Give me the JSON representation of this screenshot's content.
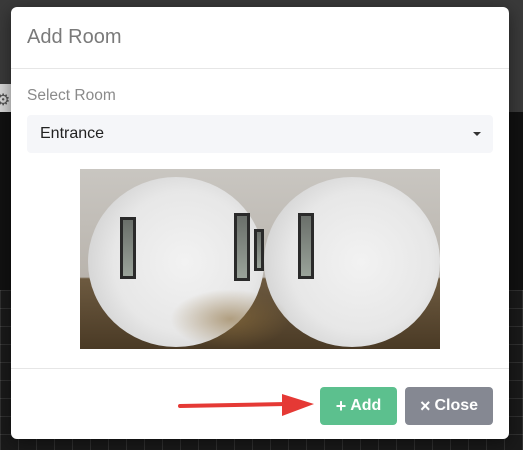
{
  "modal": {
    "title": "Add Room",
    "select_label": "Select Room",
    "selected_room": "Entrance",
    "preview_image": "360-degree panorama of hallway",
    "buttons": {
      "add_icon": "+",
      "add_label": "Add",
      "close_icon": "×",
      "close_label": "Close"
    }
  },
  "colors": {
    "add_button": "#5cc08e",
    "close_button": "#858892",
    "annotation_arrow": "#e53935"
  },
  "icons": {
    "select_caret": "chevron-down-icon",
    "background_tool": "gear-icon"
  }
}
